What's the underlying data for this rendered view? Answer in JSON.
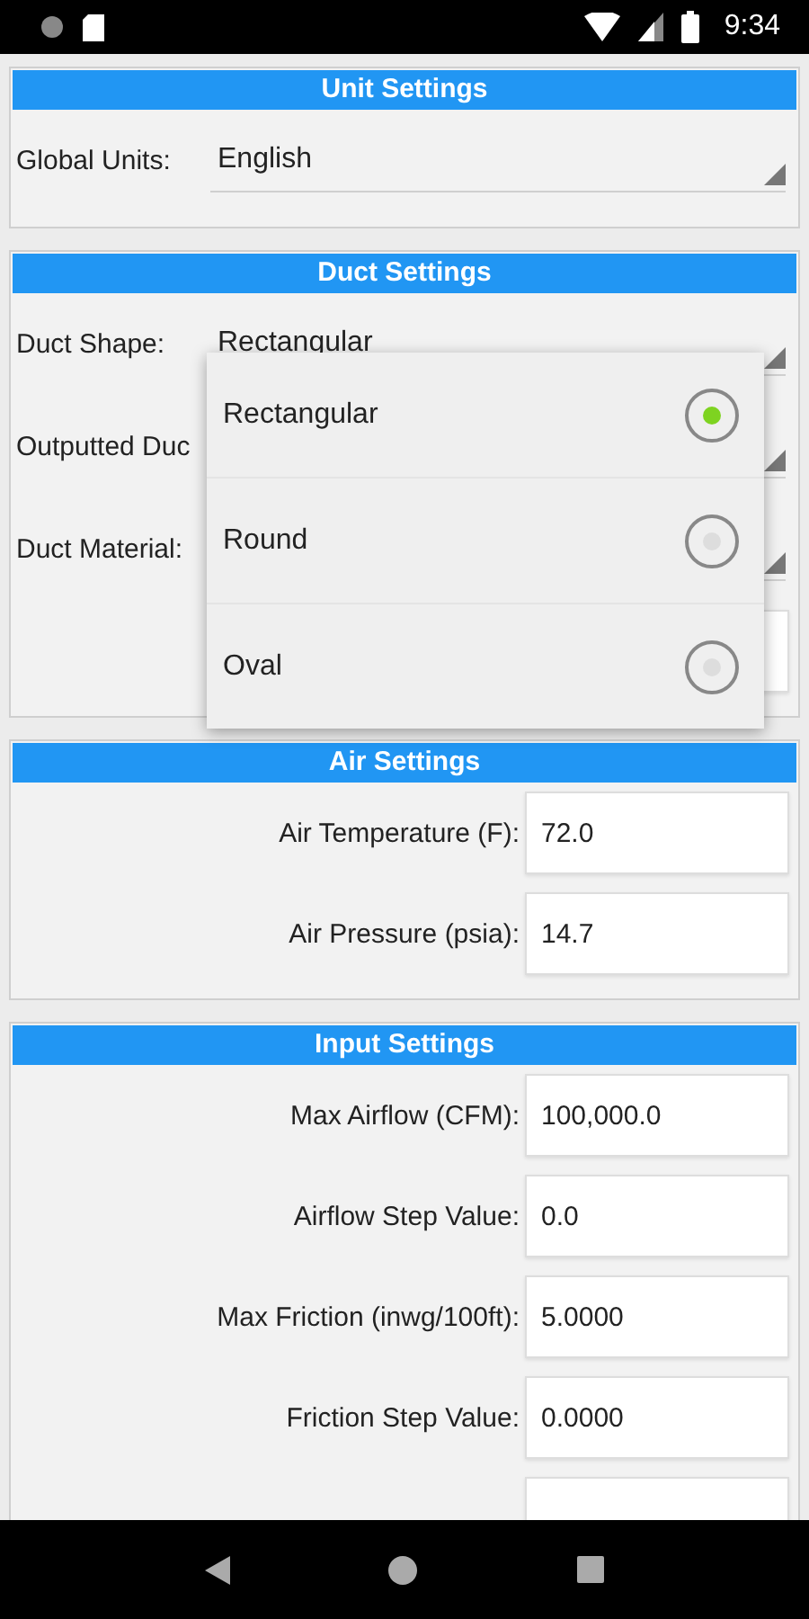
{
  "status_bar": {
    "time": "9:34"
  },
  "unit_settings": {
    "title": "Unit Settings",
    "rows": [
      {
        "kind": "dropdown",
        "label": "Global Units:",
        "value": "English"
      }
    ]
  },
  "duct_settings": {
    "title": "Duct Settings",
    "rows": [
      {
        "kind": "dropdown",
        "label": "Duct Shape:",
        "value": "Rectangular"
      },
      {
        "kind": "dropdown",
        "label": "Outputted Duc"
      },
      {
        "kind": "dropdown",
        "label": "Duct Material:"
      },
      {
        "kind": "field"
      }
    ]
  },
  "duct_shape_menu": {
    "options": [
      {
        "label": "Rectangular",
        "selected": true
      },
      {
        "label": "Round",
        "selected": false
      },
      {
        "label": "Oval",
        "selected": false
      }
    ]
  },
  "air_settings": {
    "title": "Air Settings",
    "rows": [
      {
        "kind": "field",
        "label": "Air Temperature (F):",
        "value": "72.0"
      },
      {
        "kind": "field",
        "label": "Air Pressure (psia):",
        "value": "14.7"
      }
    ]
  },
  "input_settings": {
    "title": "Input Settings",
    "rows": [
      {
        "kind": "field",
        "label": "Max Airflow (CFM):",
        "value": "100,000.0"
      },
      {
        "kind": "field",
        "label": "Airflow Step Value:",
        "value": "0.0"
      },
      {
        "kind": "field",
        "label": "Max Friction (inwg/100ft):",
        "value": "5.0000"
      },
      {
        "kind": "field",
        "label": "Friction Step Value:",
        "value": "0.0000"
      },
      {
        "kind": "field"
      }
    ]
  }
}
